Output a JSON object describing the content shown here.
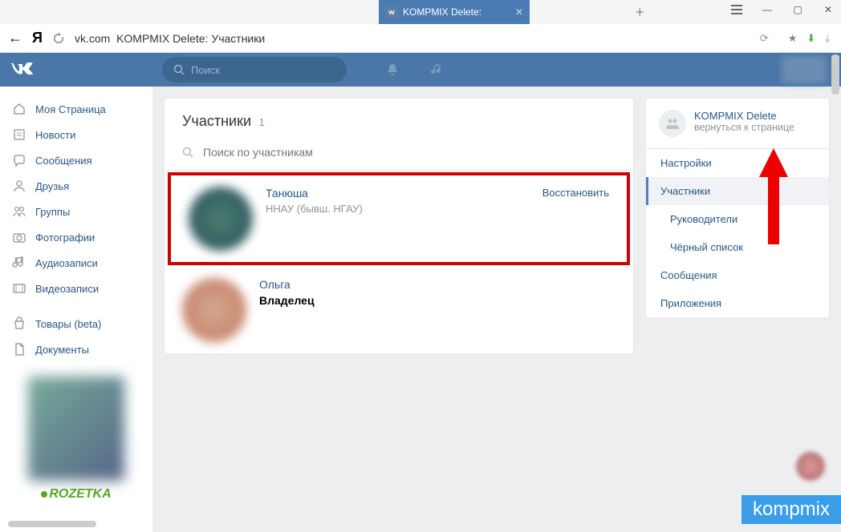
{
  "browser": {
    "tab_title": "KOMPMIX Delete:",
    "tab_vk_label": "w",
    "url_domain": "vk.com",
    "url_title": "KOMPMIX Delete: Участники"
  },
  "vk": {
    "search_placeholder": "Поиск"
  },
  "nav": {
    "items": [
      {
        "label": "Моя Страница"
      },
      {
        "label": "Новости"
      },
      {
        "label": "Сообщения"
      },
      {
        "label": "Друзья"
      },
      {
        "label": "Группы"
      },
      {
        "label": "Фотографии"
      },
      {
        "label": "Аудиозаписи"
      },
      {
        "label": "Видеозаписи"
      }
    ],
    "items2": [
      {
        "label": "Товары (beta)"
      },
      {
        "label": "Документы"
      }
    ]
  },
  "ad": {
    "brand": "ROZETKA"
  },
  "panel": {
    "title": "Участники",
    "count": "1",
    "search_placeholder": "Поиск по участникам"
  },
  "members": [
    {
      "name": "Танюша",
      "sub": "ННАУ (бывш. НГАУ)",
      "action": "Восстановить"
    },
    {
      "name": "Ольга",
      "role": "Владелец"
    }
  ],
  "right": {
    "title": "KOMPMIX Delete",
    "back": "вернуться к странице",
    "items": [
      {
        "label": "Настройки"
      },
      {
        "label": "Участники",
        "active": true
      },
      {
        "label": "Руководители",
        "indent": true
      },
      {
        "label": "Чёрный список",
        "indent": true
      },
      {
        "label": "Сообщения"
      },
      {
        "label": "Приложения"
      }
    ]
  },
  "watermark": "kompmix"
}
